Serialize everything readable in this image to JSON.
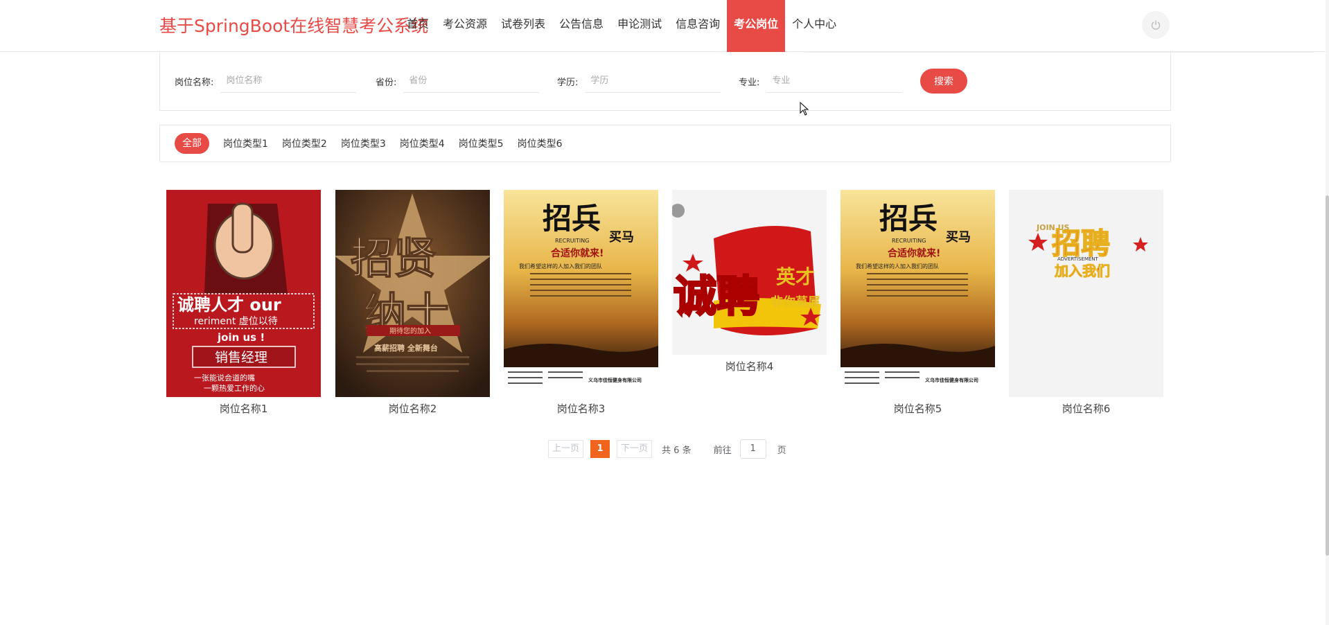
{
  "header": {
    "brand": "基于SpringBoot在线智慧考公系统",
    "nav": [
      "首页",
      "考公资源",
      "试卷列表",
      "公告信息",
      "申论测试",
      "信息咨询",
      "考公岗位",
      "个人中心"
    ],
    "active_nav": "考公岗位"
  },
  "search": {
    "fields": [
      {
        "label": "岗位名称:",
        "placeholder": "岗位名称"
      },
      {
        "label": "省份:",
        "placeholder": "省份"
      },
      {
        "label": "学历:",
        "placeholder": "学历"
      },
      {
        "label": "专业:",
        "placeholder": "专业"
      }
    ],
    "button": "搜索"
  },
  "categories": [
    "全部",
    "岗位类型1",
    "岗位类型2",
    "岗位类型3",
    "岗位类型4",
    "岗位类型5",
    "岗位类型6"
  ],
  "cards": [
    {
      "title": "岗位名称1",
      "image": {
        "lines": [
          "诚聘人才 our",
          "reriment 虚位以待",
          "join us !",
          "销售经理",
          "一张能说会道的嘴",
          "一颗热爱工作的心"
        ]
      }
    },
    {
      "title": "岗位名称2",
      "image": {
        "lines": [
          "招贤",
          "纳士",
          "期待您的加入",
          "高薪招聘 全新舞台"
        ]
      }
    },
    {
      "title": "岗位名称3",
      "image": {
        "lines": [
          "招兵",
          "买马",
          "RECRUITING",
          "合适你就来!",
          "我们希望这样的人加入我们的团队",
          "义乌市佳恒健身有限公司"
        ]
      }
    },
    {
      "title": "岗位名称4",
      "image": {
        "lines": [
          "诚聘",
          "英才",
          "非你莫属"
        ]
      }
    },
    {
      "title": "岗位名称5",
      "image": {
        "lines": [
          "招兵",
          "买马",
          "RECRUITING",
          "合适你就来!",
          "我们希望这样的人加入我们的团队",
          "义乌市佳恒健身有限公司"
        ]
      }
    },
    {
      "title": "岗位名称6",
      "image": {
        "lines": [
          "JOIN US",
          "招聘",
          "ADVERTISEMENT",
          "加入我们"
        ]
      }
    }
  ],
  "pagination": {
    "prev": "上一页",
    "current": "1",
    "next": "下一页",
    "total": "共 6 条",
    "goto": "前往",
    "goto_value": "1",
    "page_suffix": "页"
  },
  "colors": {
    "accent": "#e84a45",
    "pager_active": "#f0641e"
  }
}
